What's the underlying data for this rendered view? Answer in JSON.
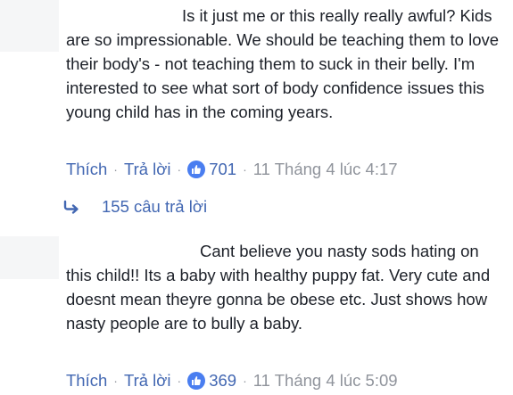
{
  "comments": [
    {
      "text": "Is it just me or this really really awful? Kids are so impressionable. We should be teaching them to love their body's - not teaching them to suck in their belly. I'm interested to see what sort of body confidence issues this young child has in the coming years.",
      "like_label": "Thích",
      "reply_label": "Trả lời",
      "like_count": "701",
      "timestamp": "11 Tháng 4 lúc 4:17",
      "replies_label": "155 câu trả lời"
    },
    {
      "text": "Cant believe you nasty sods hating on this child!! Its a baby with healthy puppy fat. Very cute and doesnt mean theyre gonna be obese etc. Just shows how nasty people are to bully a baby.",
      "like_label": "Thích",
      "reply_label": "Trả lời",
      "like_count": "369",
      "timestamp": "11 Tháng 4 lúc 5:09"
    }
  ],
  "separator": "·",
  "icons": {
    "like": "thumbs-up-icon",
    "reply_arrow": "reply-arrow-icon"
  },
  "colors": {
    "link": "#4267b2",
    "muted": "#90949c",
    "like_badge": "#4a7ef0",
    "text": "#1d2129"
  }
}
